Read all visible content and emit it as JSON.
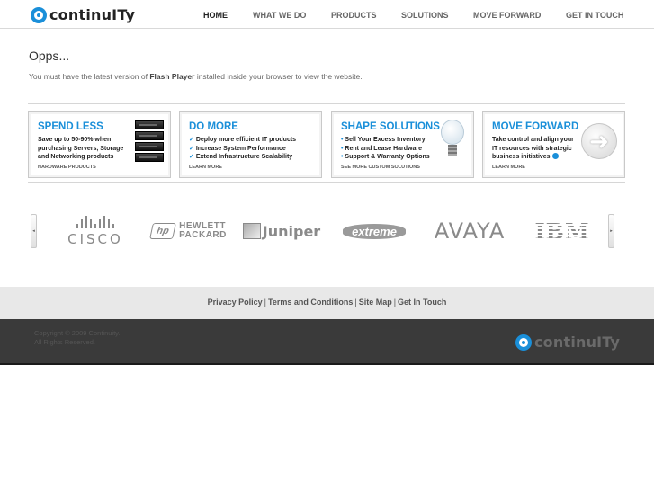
{
  "brand": {
    "name": "continuITy",
    "accent": "#1a8fd9"
  },
  "nav": {
    "items": [
      "HOME",
      "WHAT WE DO",
      "PRODUCTS",
      "SOLUTIONS",
      "MOVE FORWARD",
      "GET IN TOUCH"
    ],
    "active": "HOME"
  },
  "intro": {
    "title": "Opps...",
    "notice_before": "You must have the latest version of ",
    "notice_bold": "Flash Player",
    "notice_after": " installed inside your browser to view the website."
  },
  "promos": [
    {
      "title": "SPEND LESS",
      "lines": [
        "Save up to 50-90% when",
        "purchasing Servers, Storage",
        "and Networking products"
      ],
      "link": "HARDWARE PRODUCTS",
      "icon": "server-stack-icon"
    },
    {
      "title": "DO MORE",
      "lines": [
        "Deploy more efficient IT products",
        "Increase System Performance",
        "Extend Infrastructure Scalability"
      ],
      "link": "LEARN MORE",
      "icon": "checkmark-icon"
    },
    {
      "title": "SHAPE SOLUTIONS",
      "lines": [
        "Sell Your Excess Inventory",
        "Rent and Lease Hardware",
        "Support & Warranty Options"
      ],
      "link": "SEE MORE CUSTOM SOLUTIONS",
      "icon": "lightbulb-icon"
    },
    {
      "title": "MOVE FORWARD",
      "lines": [
        "Take control and align your",
        "IT resources with strategic",
        "business initiatives"
      ],
      "link": "LEARN MORE",
      "icon": "arrow-right-icon"
    }
  ],
  "partners": {
    "cisco": "CISCO",
    "hp_badge": "hp",
    "hp_line1": "HEWLETT",
    "hp_line2": "PACKARD",
    "juniper": "Juniper",
    "extreme": "extreme",
    "avaya": "AVAYA",
    "ibm": "IBM"
  },
  "footer": {
    "links": [
      "Privacy Policy",
      "Terms and Conditions",
      "Site Map",
      "Get In Touch"
    ],
    "separator": "|",
    "copyright_line1": "Copyright © 2009 Continuity.",
    "copyright_line2": "All Rights Reserved."
  }
}
